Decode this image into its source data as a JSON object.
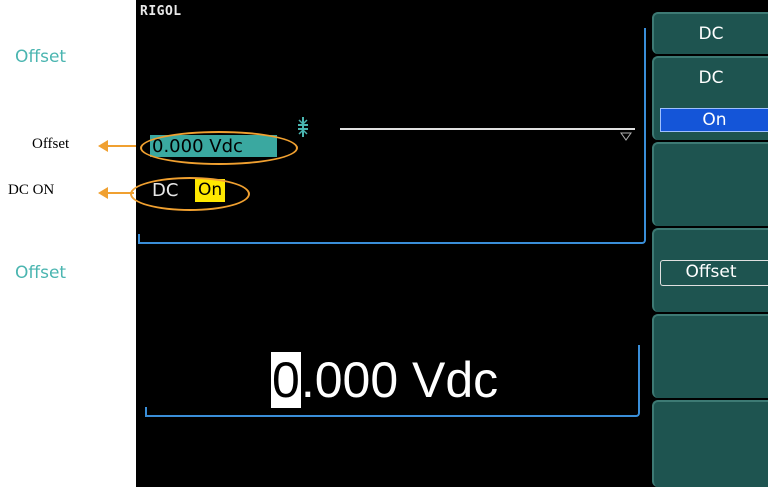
{
  "annotations": {
    "offset_label": "Offset",
    "dc_on_label": "DC ON"
  },
  "screen": {
    "brand": "RIGOL",
    "upper_title": "Offset",
    "offset_value": "0.000 Vdc",
    "dc_text": "DC",
    "on_text": "On",
    "lower_title": "Offset",
    "entry_cursor_digit": "0",
    "entry_rest": ".000 Vdc"
  },
  "softkeys": {
    "key1": "DC",
    "key2_title": "DC",
    "key2_value": "On",
    "key4": "Offset"
  },
  "colors": {
    "accent": "#3a8ed8",
    "teal": "#4ab5b0",
    "highlight": "#ffe800",
    "annotation": "#f0a030"
  }
}
